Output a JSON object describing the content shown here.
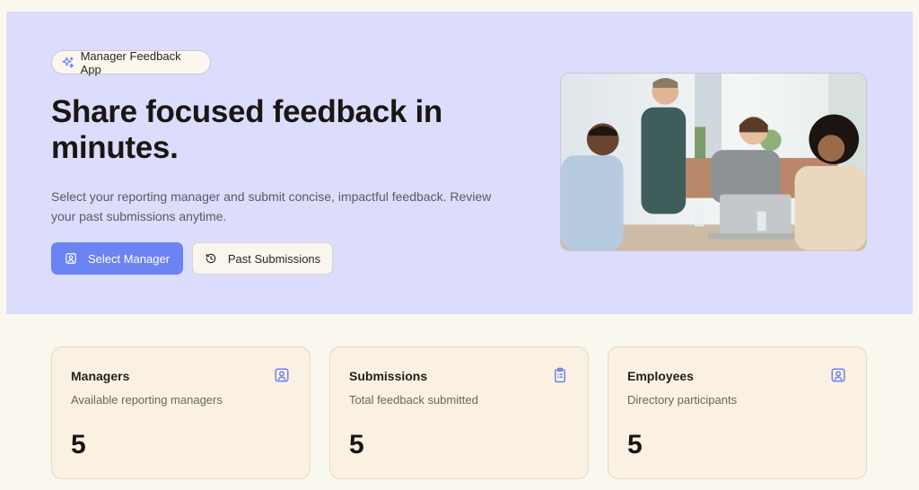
{
  "hero": {
    "badge": "Manager Feedback App",
    "headline": "Share focused feedback in minutes.",
    "subtext": "Select your reporting manager and submit concise, impactful feedback. Review your past submissions anytime.",
    "primary_button": "Select Manager",
    "secondary_button": "Past Submissions",
    "icons": {
      "badge": "sparkles-icon",
      "primary": "user-square-icon",
      "secondary": "history-icon"
    }
  },
  "stats": [
    {
      "title": "Managers",
      "subtitle": "Available reporting managers",
      "value": "5",
      "icon": "user-square-icon"
    },
    {
      "title": "Submissions",
      "subtitle": "Total feedback submitted",
      "value": "5",
      "icon": "clipboard-list-icon"
    },
    {
      "title": "Employees",
      "subtitle": "Directory participants",
      "value": "5",
      "icon": "user-square-icon"
    }
  ],
  "colors": {
    "page_background": "#faf7ef",
    "hero_background": "#dcdcfd",
    "accent": "#6b83f3",
    "card_background": "#fbf1e3"
  }
}
